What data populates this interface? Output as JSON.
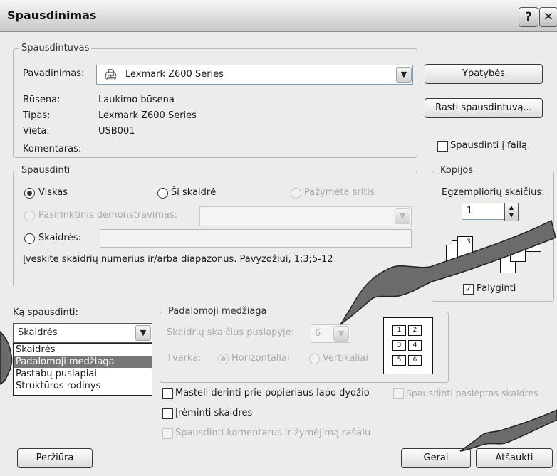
{
  "window": {
    "title": "Spausdinimas",
    "help_label": "?",
    "close_label": "✕"
  },
  "printer": {
    "legend": "Spausdintuvas",
    "name_label": "Pavadinimas:",
    "name_value": "Lexmark Z600 Series",
    "status_label": "Būsena:",
    "status_value": "Laukimo būsena",
    "type_label": "Tipas:",
    "type_value": "Lexmark Z600 Series",
    "where_label": "Vieta:",
    "where_value": "USB001",
    "comment_label": "Komentaras:",
    "properties_button": "Ypatybės",
    "find_printer_button": "Rasti spausdintuvą...",
    "print_to_file_label": "Spausdinti į failą"
  },
  "print_range": {
    "legend": "Spausdinti",
    "all_label": "Viskas",
    "current_slide_label": "Ši skaidrė",
    "selection_label": "Pažymėta sritis",
    "custom_show_label": "Pasirinktinis demonstravimas:",
    "slides_label": "Skaidrės:",
    "hint": "Įveskite skaidrių numerius ir/arba diapazonus. Pavyzdžiui, 1;3;5-12"
  },
  "copies": {
    "legend": "Kopijos",
    "count_label": "Egzempliorių skaičius:",
    "count_value": "1",
    "collate_label": "Palyginti"
  },
  "print_what": {
    "label": "Ką spausdinti:",
    "selected": "Skaidrės",
    "options": [
      "Skaidrės",
      "Padalomoji medžiaga",
      "Pastabų puslapiai",
      "Struktūros rodinys"
    ],
    "highlighted_index": 1
  },
  "handouts": {
    "legend": "Padalomoji medžiaga",
    "per_page_label": "Skaidrių skaičius puslapyje:",
    "per_page_value": "6",
    "order_label": "Tvarka:",
    "horizontal_label": "Horizontaliai",
    "vertical_label": "Vertikaliai",
    "preview_numbers": [
      "1",
      "2",
      "3",
      "4",
      "5",
      "6"
    ]
  },
  "options": {
    "scale_to_fit": "Masteli derinti prie popieriaus lapo dydžio",
    "print_hidden": "Spausdinti paslėptas skaidres",
    "frame_slides": "Įrėminti skaidres",
    "print_comments": "Spausdinti komentarus ir žymėjimą rašalu"
  },
  "footer": {
    "preview_button": "Peržiūra",
    "ok_button": "Gerai",
    "cancel_button": "Atšaukti"
  },
  "colors": {
    "dialog_bg": "#ececea",
    "highlight": "#777777",
    "hand": "#6b6b6b"
  }
}
